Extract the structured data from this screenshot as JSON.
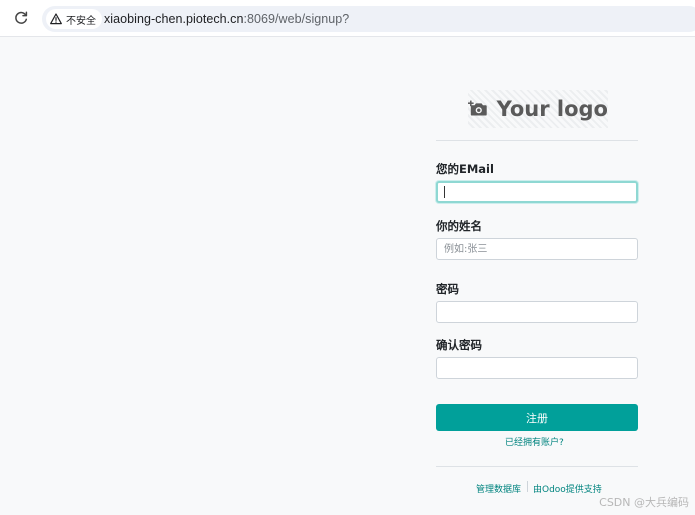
{
  "browser": {
    "security_label": "不安全",
    "url_host": "xiaobing-chen.piotech.cn",
    "url_path": ":8069/web/signup?"
  },
  "logo": {
    "text": "Your logo"
  },
  "form": {
    "email_label": "您的EMail",
    "email_value": "",
    "name_label": "你的姓名",
    "name_placeholder": "例如:张三",
    "password_label": "密码",
    "confirm_label": "确认密码",
    "submit_label": "注册",
    "have_account_link": "已经拥有账户?"
  },
  "footer": {
    "manage_db_link": "管理数据库",
    "powered_by_link": "由Odoo提供支持"
  },
  "watermark": "CSDN @大兵编码",
  "colors": {
    "primary": "#01a09a",
    "link": "#01847f",
    "focus_ring": "#8fd8d3"
  }
}
